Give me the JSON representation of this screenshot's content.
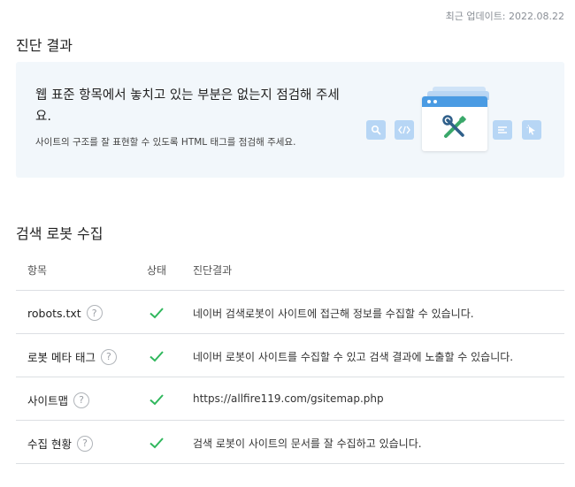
{
  "updated": "최근 업데이트: 2022.08.22",
  "diagnosis": {
    "title": "진단 결과",
    "headline": "웹 표준 항목에서 놓치고 있는 부분은 없는지 점검해 주세요.",
    "sub": "사이트의 구조를 잘 표현할 수 있도록 HTML 태그를 점검해 주세요."
  },
  "robot": {
    "title": "검색 로봇 수집",
    "headers": {
      "item": "항목",
      "status": "상태",
      "result": "진단결과"
    },
    "help_glyph": "?",
    "rows": [
      {
        "item": "robots.txt",
        "status": "ok",
        "result": "네이버 검색로봇이 사이트에 접근해 정보를 수집할 수 있습니다."
      },
      {
        "item": "로봇 메타 태그",
        "status": "ok",
        "result": "네이버 로봇이 사이트를 수집할 수 있고 검색 결과에 노출할 수 있습니다."
      },
      {
        "item": "사이트맵",
        "status": "ok",
        "result": "https://allfire119.com/gsitemap.php"
      },
      {
        "item": "수집 현황",
        "status": "ok",
        "result": "검색 로봇이 사이트의 문서를 잘 수집하고 있습니다."
      }
    ]
  },
  "colors": {
    "accent": "#4a9be3",
    "check": "#2fb75c",
    "banner_bg": "#f2f7fb"
  },
  "icons": [
    "search-icon",
    "code-icon",
    "list-icon",
    "cursor-icon",
    "tools-icon",
    "check-icon",
    "help-icon"
  ]
}
